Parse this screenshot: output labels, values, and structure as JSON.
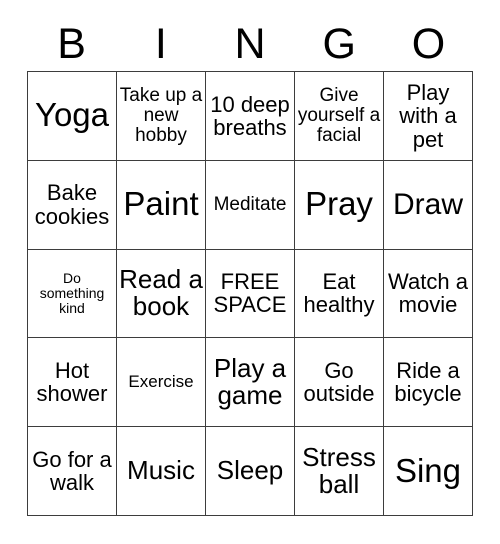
{
  "card": {
    "title_letters": [
      "B",
      "I",
      "N",
      "G",
      "O"
    ],
    "colors": {
      "border": "#3d3d3d",
      "text": "#000000",
      "background": "#ffffff"
    },
    "grid": {
      "columns": 5,
      "rows": 5,
      "free_space_label": "FREE SPACE"
    },
    "cells": [
      {
        "text": "Yoga",
        "size": "fs-xxl"
      },
      {
        "text": "Take up a new hobby",
        "size": "fs-sm"
      },
      {
        "text": "10 deep breaths",
        "size": "fs-md"
      },
      {
        "text": "Give yourself a facial",
        "size": "fs-sm"
      },
      {
        "text": "Play with a pet",
        "size": "fs-md"
      },
      {
        "text": "Bake cookies",
        "size": "fs-md"
      },
      {
        "text": "Paint",
        "size": "fs-xxl"
      },
      {
        "text": "Meditate",
        "size": "fs-sm"
      },
      {
        "text": "Pray",
        "size": "fs-xxl"
      },
      {
        "text": "Draw",
        "size": "fs-xl"
      },
      {
        "text": "Do something kind",
        "size": "fs-xxs"
      },
      {
        "text": "Read a book",
        "size": "fs-lg"
      },
      {
        "text": "FREE SPACE",
        "size": "fs-md"
      },
      {
        "text": "Eat healthy",
        "size": "fs-md"
      },
      {
        "text": "Watch a movie",
        "size": "fs-md"
      },
      {
        "text": "Hot shower",
        "size": "fs-md"
      },
      {
        "text": "Exercise",
        "size": "fs-xs"
      },
      {
        "text": "Play a game",
        "size": "fs-lg"
      },
      {
        "text": "Go outside",
        "size": "fs-md"
      },
      {
        "text": "Ride a bicycle",
        "size": "fs-md"
      },
      {
        "text": "Go for a walk",
        "size": "fs-md"
      },
      {
        "text": "Music",
        "size": "fs-lg"
      },
      {
        "text": "Sleep",
        "size": "fs-lg"
      },
      {
        "text": "Stress ball",
        "size": "fs-lg"
      },
      {
        "text": "Sing",
        "size": "fs-xxl"
      }
    ]
  }
}
